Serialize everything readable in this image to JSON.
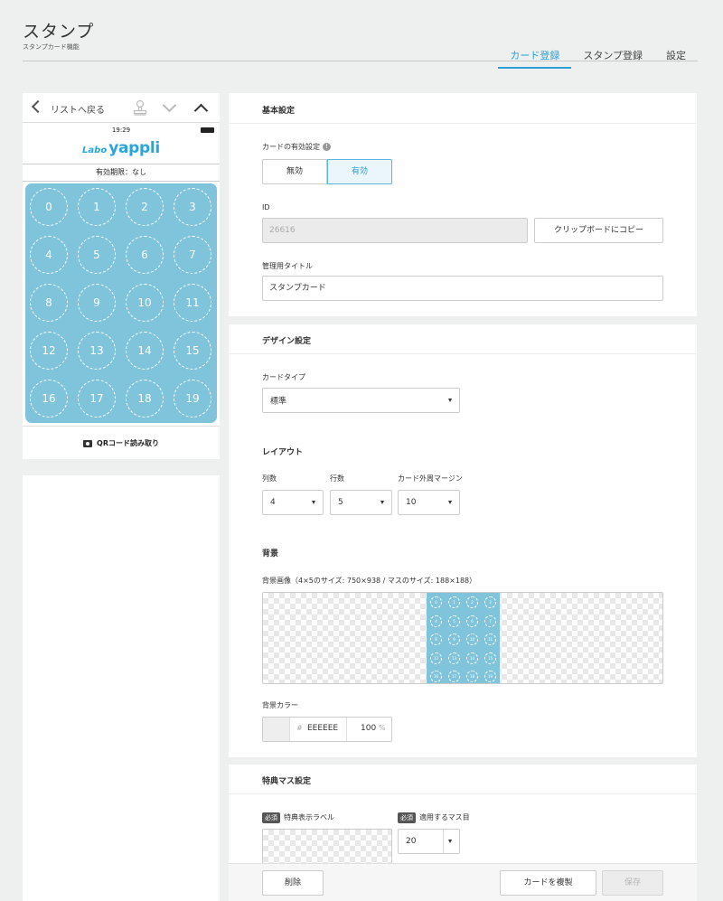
{
  "header": {
    "title": "スタンプ",
    "subtitle": "スタンプカード機能",
    "tabs": [
      {
        "label": "カード登録",
        "active": true
      },
      {
        "label": "スタンプ登録",
        "active": false
      },
      {
        "label": "設定",
        "active": false
      }
    ]
  },
  "preview": {
    "back_label": "リストへ戻る",
    "status_time": "19:29",
    "logo_labo": "Labo",
    "logo_yappli": "yappli",
    "expiry": "有効期限：なし",
    "card_color": "#7fc4db",
    "cells": [
      "0",
      "1",
      "2",
      "3",
      "4",
      "5",
      "6",
      "7",
      "8",
      "9",
      "10",
      "11",
      "12",
      "13",
      "14",
      "15",
      "16",
      "17",
      "18",
      "19"
    ],
    "qr_label": "QRコード読み取り",
    "icons": [
      "chevron-left-icon",
      "stamp-icon",
      "chevron-down-icon",
      "chevron-up-icon",
      "gift-icon",
      "camera-icon"
    ]
  },
  "basic": {
    "title": "基本設定",
    "enable_label": "カードの有効設定",
    "help_glyph": "!",
    "toggle_off": "無効",
    "toggle_on": "有効",
    "id_label": "ID",
    "id_value": "26616",
    "copy_button": "クリップボードにコピー",
    "admin_title_label": "管理用タイトル",
    "admin_title_value": "スタンプカード"
  },
  "design": {
    "title": "デザイン設定",
    "card_type_label": "カードタイプ",
    "card_type_value": "標準",
    "layout_title": "レイアウト",
    "columns_label": "列数",
    "columns_value": "4",
    "rows_label": "行数",
    "rows_value": "5",
    "margin_label": "カード外周マージン",
    "margin_value": "10",
    "background_title": "背景",
    "bg_image_label": "背景画像（4×5のサイズ: 750×938 / マスのサイズ: 188×188）",
    "bg_color_label": "背景カラー",
    "hash": "#",
    "bg_color_value": "EEEEEE",
    "opacity_value": "100",
    "opacity_unit": "%",
    "swatch_color": "#eeeeee"
  },
  "bonus": {
    "title": "特典マス設定",
    "required_badge": "必須",
    "label_field_label": "特典表示ラベル",
    "target_label": "適用するマス目",
    "target_value": "20"
  },
  "footer": {
    "delete_button": "削除",
    "duplicate_button": "カードを複製",
    "save_button": "保存"
  }
}
